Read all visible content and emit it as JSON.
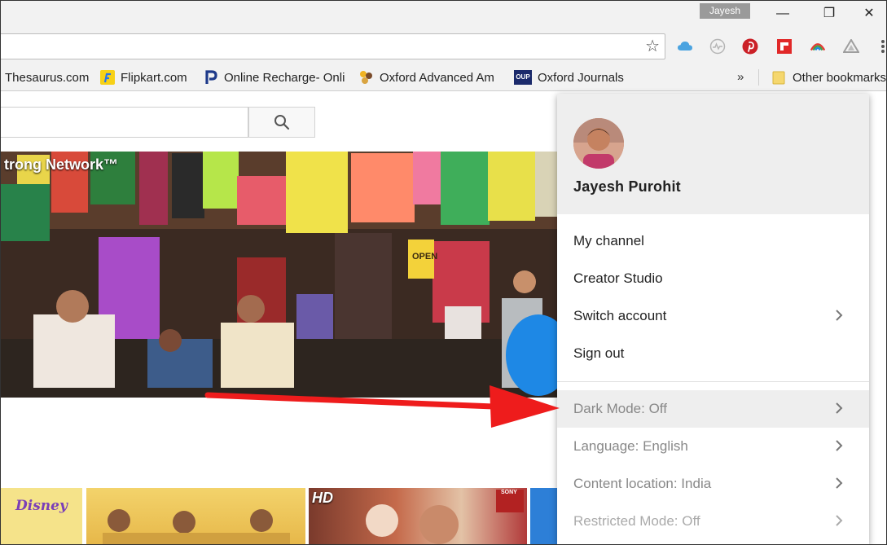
{
  "window": {
    "user_badge": "Jayesh",
    "minimize_glyph": "—",
    "maximize_glyph": "❐",
    "close_glyph": "✕"
  },
  "toolbar": {
    "omnibox_value": "",
    "star_glyph": "☆",
    "extensions": [
      "cloud-icon",
      "tracker-icon",
      "pinterest-icon",
      "flipboard-icon",
      "rainbow-icon",
      "drive-icon",
      "menu-icon"
    ]
  },
  "bookmarks": {
    "items": [
      {
        "label": "Thesaurus.com"
      },
      {
        "label": "Flipkart.com"
      },
      {
        "label": "Online Recharge- Onli"
      },
      {
        "label": "Oxford Advanced Am"
      },
      {
        "label": "Oxford Journals",
        "badge": "OUP"
      }
    ],
    "overflow": "»",
    "other": "Other bookmarks"
  },
  "page": {
    "search_value": "",
    "banner_title": "trong Network™",
    "thumb_texts": {
      "disney": "Disney",
      "hd": "HD",
      "sony": "SONY"
    }
  },
  "menu": {
    "name": "Jayesh Purohit",
    "items": [
      {
        "label": "My channel"
      },
      {
        "label": "Creator Studio"
      },
      {
        "label": "Switch account"
      },
      {
        "label": "Sign out"
      },
      {
        "label": "Dark Mode: Off"
      },
      {
        "label": "Language: English"
      },
      {
        "label": "Content location: India"
      },
      {
        "label": "Restricted Mode: Off"
      }
    ]
  },
  "colors": {
    "annotation_arrow": "#ee1c1c",
    "highlight_row": "#eeeeee",
    "pinterest": "#cb2027",
    "flipboard": "#e12828"
  }
}
